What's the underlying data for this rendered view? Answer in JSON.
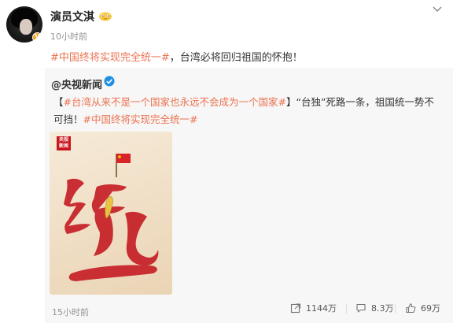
{
  "post": {
    "username": "演员文淇",
    "time": "10小时前",
    "text_topic": "#中国终将实现完全统一#",
    "text_rest": "，台湾必将回归祖国的怀抱！"
  },
  "repost": {
    "username": "@央视新闻",
    "text_bracket_open": "【",
    "text_topic1": "#台湾从来不是一个国家也永远不会成为一个国家#",
    "text_bracket_close": "】",
    "text_body": "“台独”死路一条，祖国统一势不可挡！",
    "text_topic2": "#中国终将实现完全统一#",
    "poster": {
      "logo_text": "央视新闻",
      "big_character": "统一"
    },
    "time": "15小时前",
    "actions": {
      "repost_count": "1144万",
      "comment_count": "8.3万",
      "like_count": "69万"
    }
  },
  "colors": {
    "topic": "#eb7350",
    "repost_bg": "#f7f7f7",
    "poster_red": "#c8161d"
  }
}
